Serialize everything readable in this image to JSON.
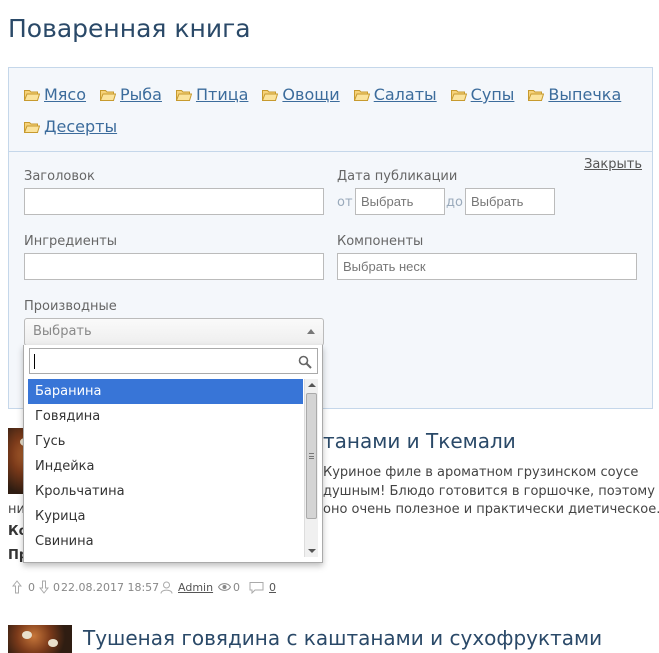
{
  "page": {
    "title": "Поваренная книга"
  },
  "categories": [
    {
      "label": "Мясо"
    },
    {
      "label": "Рыба"
    },
    {
      "label": "Птица"
    },
    {
      "label": "Овощи"
    },
    {
      "label": "Салаты"
    },
    {
      "label": "Супы"
    },
    {
      "label": "Выпечка"
    },
    {
      "label": "Десерты"
    }
  ],
  "filter": {
    "close_label": "Закрыть",
    "title_label": "Заголовок",
    "title_value": "",
    "date_label": "Дата публикации",
    "date_from_label": "от",
    "date_from_placeholder": "Выбрать",
    "date_to_label": "до",
    "date_to_placeholder": "Выбрать",
    "ingredients_label": "Ингредиенты",
    "ingredients_value": "",
    "components_label": "Компоненты",
    "components_placeholder": "Выбрать неск",
    "derivatives_label": "Производные",
    "derivatives_selected": "Выбрать"
  },
  "dropdown": {
    "search_value": "",
    "options": [
      "Баранина",
      "Говядина",
      "Гусь",
      "Индейка",
      "Крольчатина",
      "Курица",
      "Свинина"
    ],
    "highlighted": "Баранина"
  },
  "recipes": [
    {
      "title_fragment": "танами и Ткемали",
      "desc_lines": [
        "Куриное филе в ароматном грузинском соусе",
        "душным! Блюдо готовится в горшочке, поэтому",
        "ни",
        "оно очень полезное и практически диетическое."
      ],
      "bold_fragments": [
        "Ко",
        "Пр"
      ],
      "meta": {
        "up": "0",
        "down": "0",
        "date": "22.08.2017 18:57",
        "author": "Admin",
        "views": "0",
        "comments": "0"
      }
    },
    {
      "title": "Тушеная говядина с каштанами и сухофруктами"
    }
  ],
  "colors": {
    "accent": "#2a4968",
    "link": "#3c6c9c",
    "highlight": "#3875d7",
    "panel": "#f4f7fb"
  }
}
